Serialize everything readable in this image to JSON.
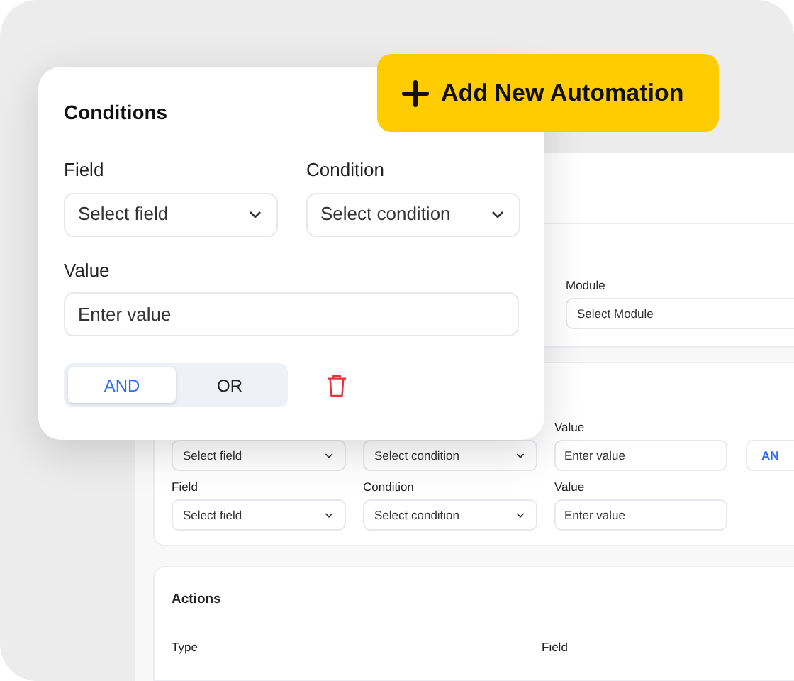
{
  "add_button": {
    "label": "Add New Automation"
  },
  "conditions_card": {
    "title": "Conditions",
    "field": {
      "label": "Field",
      "placeholder": "Select field"
    },
    "condition": {
      "label": "Condition",
      "placeholder": "Select condition"
    },
    "value": {
      "label": "Value",
      "placeholder": "Enter value"
    },
    "logic": [
      {
        "label": "AND",
        "selected": true
      },
      {
        "label": "OR",
        "selected": false
      }
    ]
  },
  "background": {
    "module": {
      "label": "Module",
      "placeholder": "Select Module"
    },
    "condition_rows": [
      {
        "field": {
          "placeholder": "Select field"
        },
        "condition": {
          "placeholder": "Select condition"
        },
        "value": {
          "label": "Value",
          "placeholder": "Enter value"
        },
        "logic_button": {
          "label": "AN"
        }
      },
      {
        "field": {
          "label": "Field",
          "placeholder": "Select field"
        },
        "condition": {
          "label": "Condition",
          "placeholder": "Select condition"
        },
        "value": {
          "label": "Value",
          "placeholder": "Enter value"
        }
      }
    ],
    "actions": {
      "title": "Actions",
      "columns": [
        "Type",
        "Field"
      ]
    }
  }
}
